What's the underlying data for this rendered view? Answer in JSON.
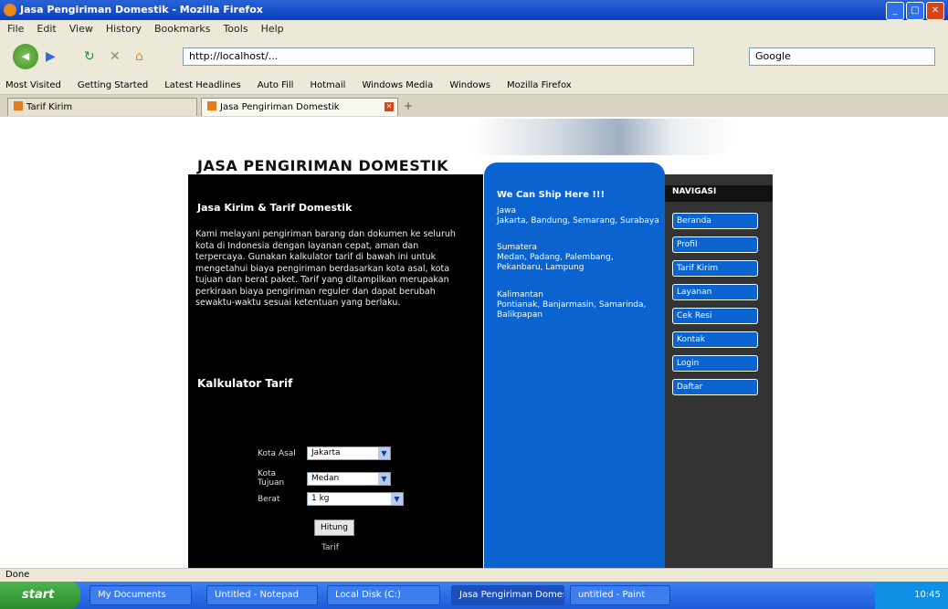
{
  "window": {
    "title": "Jasa Pengiriman Domestik - Mozilla Firefox"
  },
  "menu": [
    "File",
    "Edit",
    "View",
    "History",
    "Bookmarks",
    "Tools",
    "Help"
  ],
  "nav": {
    "url": "http://localhost/...",
    "search_placeholder": "Google"
  },
  "bookmarks": [
    "Most Visited",
    "Getting Started",
    "Latest Headlines",
    "Auto Fill",
    "Hotmail",
    "Windows Media",
    "Windows",
    "Mozilla Firefox"
  ],
  "tabs": [
    {
      "label": "Tarif Kirim"
    },
    {
      "label": "Jasa Pengiriman Domestik"
    }
  ],
  "page": {
    "title": "JASA PENGIRIMAN DOMESTIK",
    "left": {
      "heading": "Jasa Kirim & Tarif Domestik",
      "paragraph": "Kami melayani pengiriman barang dan dokumen ke seluruh kota di Indonesia dengan layanan cepat, aman dan terpercaya. Gunakan kalkulator tarif di bawah ini untuk mengetahui biaya pengiriman berdasarkan kota asal, kota tujuan dan berat paket. Tarif yang ditampilkan merupakan perkiraan biaya pengiriman reguler dan dapat berubah sewaktu-waktu sesuai ketentuan yang berlaku.",
      "calc_heading": "Kalkulator Tarif",
      "form": [
        {
          "label": "Kota Asal",
          "value": "Jakarta"
        },
        {
          "label": "Kota Tujuan",
          "value": "Medan"
        },
        {
          "label": "Berat",
          "value": "1 kg"
        }
      ],
      "button": "Hitung",
      "result": "Tarif"
    },
    "center": {
      "heading": "We Can Ship Here !!!",
      "blocks": [
        "Jawa\nJakarta, Bandung, Semarang, Surabaya",
        "Sumatera\nMedan, Padang, Palembang, Pekanbaru, Lampung",
        "Kalimantan\nPontianak, Banjarmasin, Samarinda, Balikpapan"
      ]
    },
    "sidebar": {
      "heading": "NAVIGASI",
      "items": [
        "Beranda",
        "Profil",
        "Tarif Kirim",
        "Layanan",
        "Cek Resi",
        "Kontak",
        "Login",
        "Daftar"
      ]
    }
  },
  "status": "Done",
  "taskbar": {
    "start": "start",
    "items": [
      "My Documents",
      "Untitled - Notepad",
      "Local Disk (C:)",
      "Jasa Pengiriman Domestik",
      "untitled - Paint"
    ],
    "clock": "10:45"
  }
}
